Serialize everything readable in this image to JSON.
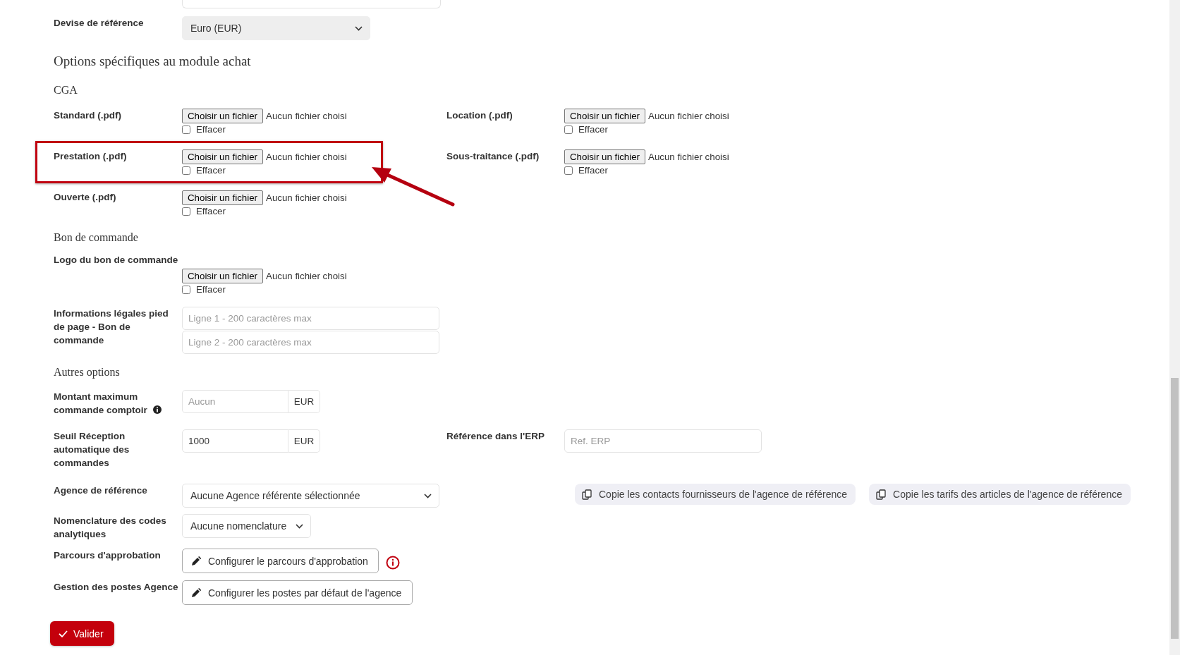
{
  "currency": {
    "label": "Devise de référence",
    "value": "Euro (EUR)"
  },
  "section_title": "Options spécifiques au module achat",
  "cga": {
    "title": "CGA",
    "files": [
      {
        "label": "Standard (.pdf)",
        "button": "Choisir un fichier",
        "status": "Aucun fichier choisi",
        "clear_label": "Effacer",
        "clear_checked": false,
        "highlighted": false
      },
      {
        "label": "Location (.pdf)",
        "button": "Choisir un fichier",
        "status": "Aucun fichier choisi",
        "clear_label": "Effacer",
        "clear_checked": false,
        "highlighted": false
      },
      {
        "label": "Prestation (.pdf)",
        "button": "Choisir un fichier",
        "status": "Aucun fichier choisi",
        "clear_label": "Effacer",
        "clear_checked": false,
        "highlighted": true
      },
      {
        "label": "Sous-traitance (.pdf)",
        "button": "Choisir un fichier",
        "status": "Aucun fichier choisi",
        "clear_label": "Effacer",
        "clear_checked": false,
        "highlighted": false
      },
      {
        "label": "Ouverte (.pdf)",
        "button": "Choisir un fichier",
        "status": "Aucun fichier choisi",
        "clear_label": "Effacer",
        "clear_checked": false,
        "highlighted": false
      }
    ]
  },
  "purchase_order": {
    "title": "Bon de commande",
    "logo": {
      "label": "Logo du bon de commande",
      "button": "Choisir un fichier",
      "status": "Aucun fichier choisi",
      "clear_label": "Effacer",
      "clear_checked": false
    },
    "legal": {
      "label": "Informations légales pied de page - Bon de commande",
      "placeholders": [
        "Ligne 1 - 200 caractères max",
        "Ligne 2 - 200 caractères max"
      ]
    }
  },
  "other_options": {
    "title": "Autres options",
    "max_amount": {
      "label": "Montant maximum commande comptoir",
      "placeholder": "Aucun",
      "unit": "EUR"
    },
    "threshold": {
      "label": "Seuil Réception automatique des commandes",
      "value": "1000",
      "unit": "EUR"
    },
    "erp_reference": {
      "label": "Référence dans l'ERP",
      "placeholder": "Ref. ERP"
    },
    "agency": {
      "label": "Agence de référence",
      "value": "Aucune Agence référente sélectionnée"
    },
    "copy_buttons": [
      "Copie les contacts fournisseurs de l'agence de référence",
      "Copie les tarifs des articles de l'agence de référence"
    ],
    "nomenclature": {
      "label": "Nomenclature des codes analytiques",
      "value": "Aucune nomenclature"
    },
    "approval": {
      "label": "Parcours d'approbation",
      "button": "Configurer le parcours d'approbation",
      "warning": true
    },
    "positions": {
      "label": "Gestion des postes Agence",
      "button": "Configurer les postes par défaut de l'agence"
    }
  },
  "submit": "Valider"
}
